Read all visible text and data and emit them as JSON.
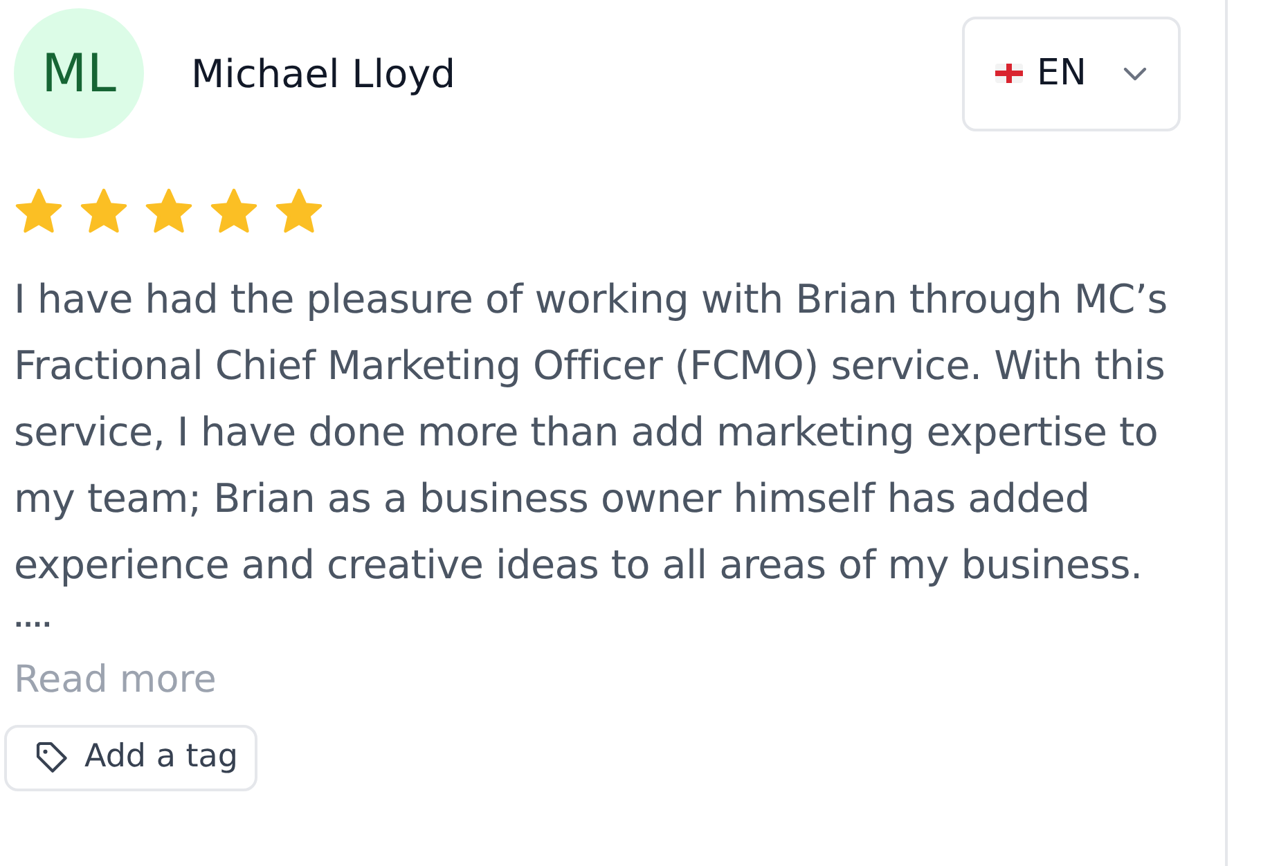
{
  "reviewer": {
    "initials": "ML",
    "name": "Michael Lloyd"
  },
  "language": {
    "label": "EN"
  },
  "rating": {
    "stars": 5
  },
  "review": {
    "text": "I have had the pleasure of working with Brian through MC’s Fractional Chief Marketing Officer (FCMO) service. With this service, I have done more than add marketing expertise to my team; Brian as a business owner himself has added experience and creative ideas to all areas of my business.",
    "ellipsis": "....",
    "read_more": "Read more"
  },
  "tag_button": {
    "label": "Add a tag"
  }
}
